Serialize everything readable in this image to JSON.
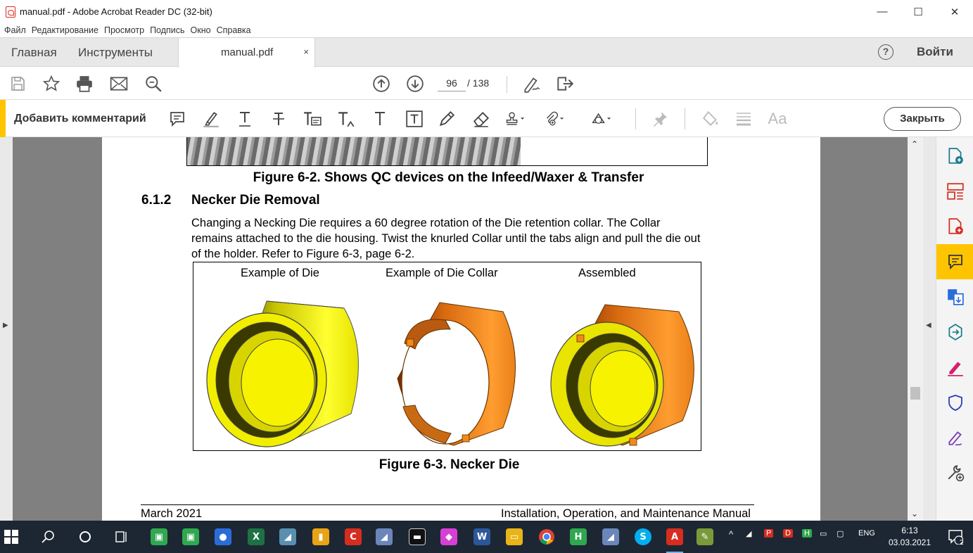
{
  "window": {
    "title": "manual.pdf - Adobe Acrobat Reader DC (32-bit)",
    "controls": {
      "minimize": "—",
      "maximize": "☐",
      "close": "✕"
    }
  },
  "menu": [
    "Файл",
    "Редактирование",
    "Просмотр",
    "Подпись",
    "Окно",
    "Справка"
  ],
  "tabs": {
    "home": "Главная",
    "tools": "Инструменты",
    "document": "manual.pdf",
    "close": "×",
    "help": "?",
    "signin": "Войти"
  },
  "toolbar": {
    "page_current": "96",
    "page_total": "/ 138",
    "icons": [
      "save-icon",
      "bookmark-star-icon",
      "print-icon",
      "email-icon",
      "zoom-search-icon",
      "page-up-icon",
      "page-down-icon",
      "sign-pen-icon",
      "share-icon"
    ]
  },
  "commentbar": {
    "label": "Добавить комментарий",
    "close": "Закрыть",
    "text_tool": "Aa"
  },
  "document": {
    "fig2_caption": "Figure 6-2. Shows QC devices on the Infeed/Waxer & Transfer",
    "section_number": "6.1.2",
    "section_title": "Necker Die Removal",
    "paragraph_lines": [
      "Changing a Necking Die requires a 60 degree rotation of the Die retention collar. The Collar",
      "remains attached to the die housing. Twist the knurled Collar until the tabs align and pull the die out",
      "of the holder. Refer to Figure 6-3, page 6-2."
    ],
    "fig3_labels": {
      "die": "Example of Die",
      "collar": "Example of Die Collar",
      "assembled": "Assembled"
    },
    "fig3_caption": "Figure 6-3. Necker Die",
    "footer_left": "March 2021",
    "footer_right": "Installation, Operation, and Maintenance Manual"
  },
  "colors": {
    "accent": "#ffc400",
    "acrobat_red": "#d62d20",
    "die_yellow": "#f2ee00",
    "collar_orange": "#f08a1a"
  },
  "taskbar": {
    "tray_lang": "ENG",
    "time": "6:13",
    "date": "03.03.2021",
    "notifications": "2"
  }
}
